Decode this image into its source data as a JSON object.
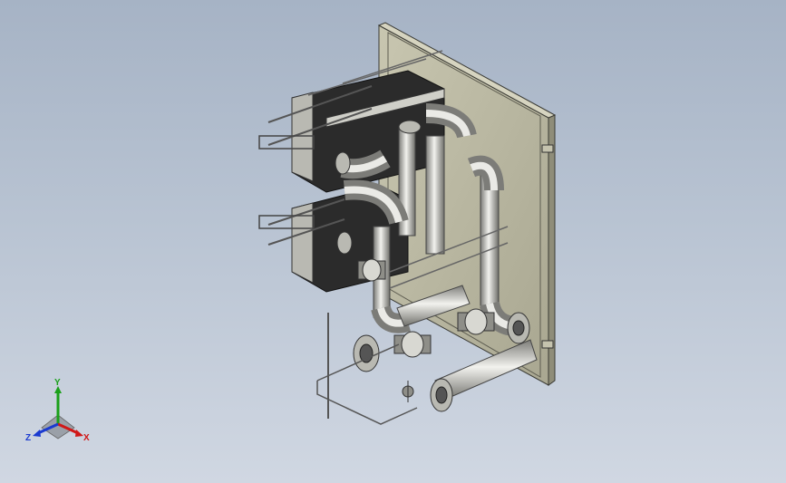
{
  "viewport": {
    "background_top": "#a6b3c5",
    "background_bottom": "#d0d7e2",
    "model_color_metal": "#c9c9c2",
    "model_color_frame": "#b8b69f",
    "model_color_plates": "#2a2a2a"
  },
  "triad": {
    "x_label": "X",
    "y_label": "Y",
    "z_label": "Z",
    "x_color": "#d01818",
    "y_color": "#1aa01a",
    "z_color": "#1a3ad0"
  }
}
